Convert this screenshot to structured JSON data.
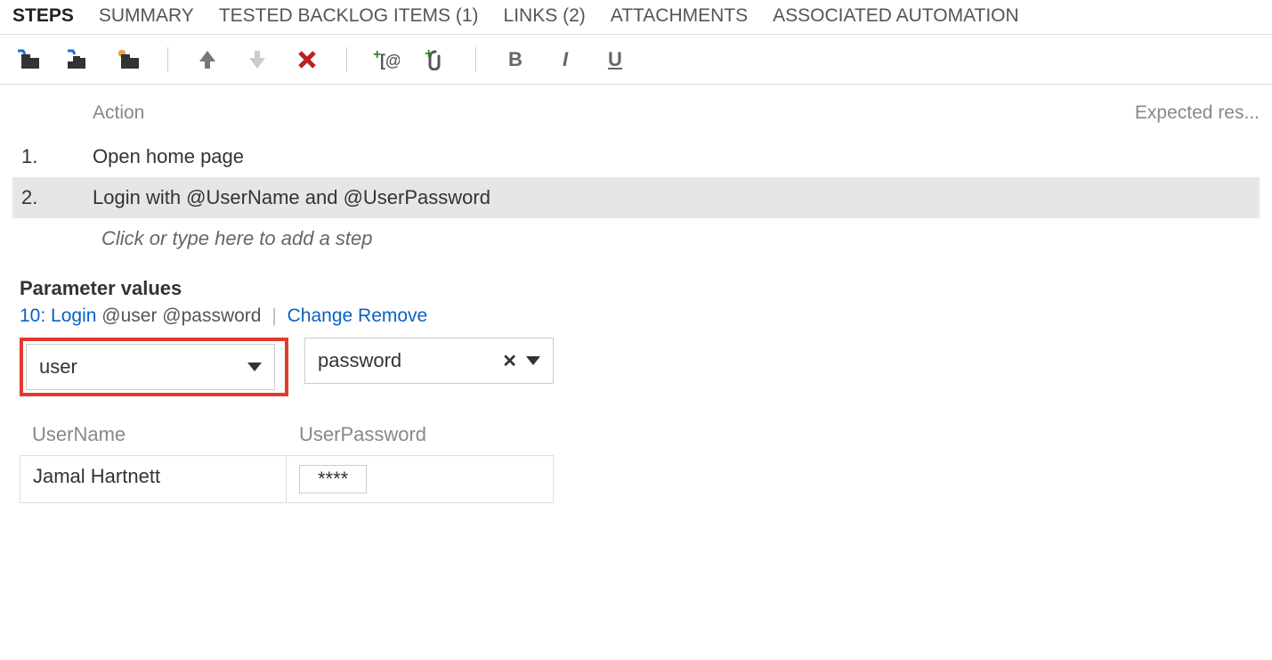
{
  "tabs": [
    {
      "label": "STEPS"
    },
    {
      "label": "SUMMARY"
    },
    {
      "label": "TESTED BACKLOG ITEMS (1)"
    },
    {
      "label": "LINKS (2)"
    },
    {
      "label": "ATTACHMENTS"
    },
    {
      "label": "ASSOCIATED AUTOMATION"
    }
  ],
  "columns": {
    "action": "Action",
    "expected": "Expected res..."
  },
  "steps": [
    {
      "num": "1.",
      "action": "Open home page"
    },
    {
      "num": "2.",
      "action": "Login with  @UserName and  @UserPassword"
    }
  ],
  "add_step_placeholder": "Click or type here to add a step",
  "params": {
    "title": "Parameter values",
    "link_id": "10: Login",
    "link_suffix": "@user @password",
    "change": "Change",
    "remove": "Remove",
    "dropdowns": [
      {
        "value": "user"
      },
      {
        "value": "password"
      }
    ],
    "table": {
      "headers": [
        "UserName",
        "UserPassword"
      ],
      "row": [
        "Jamal Hartnett",
        "****"
      ]
    }
  }
}
